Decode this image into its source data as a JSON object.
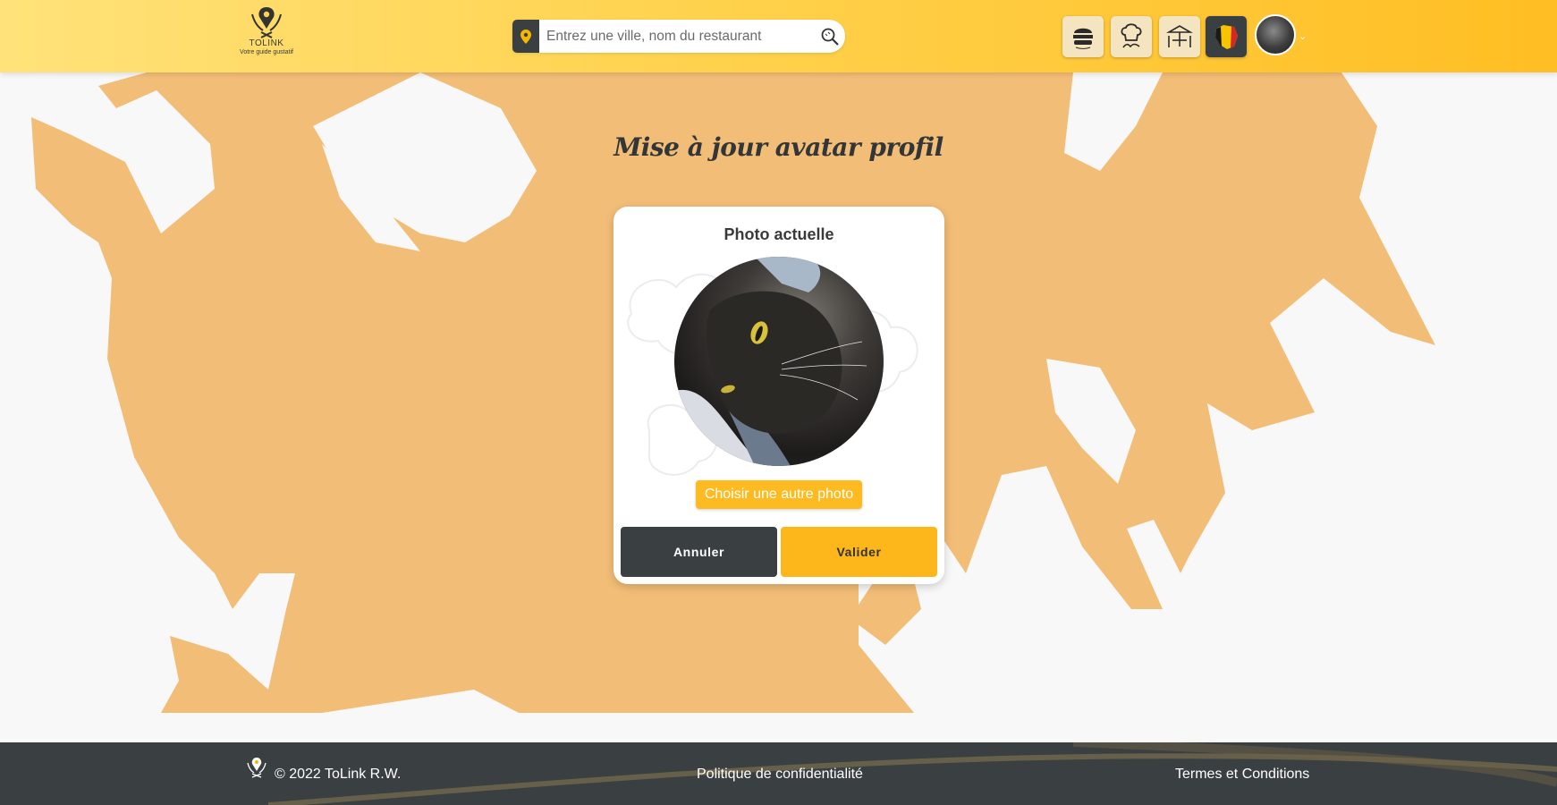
{
  "header": {
    "logo": {
      "name": "TOLINK",
      "tagline": "Votre guide gustatif"
    },
    "search": {
      "placeholder": "Entrez une ville, nom du restaurant",
      "value": ""
    },
    "category_tiles": [
      {
        "name": "burger-tile",
        "icon": "burger-icon"
      },
      {
        "name": "chef-tile",
        "icon": "chef-hat-icon"
      },
      {
        "name": "terrace-tile",
        "icon": "table-umbrella-icon"
      },
      {
        "name": "belgium-tile",
        "icon": "belgium-map-icon"
      }
    ]
  },
  "main": {
    "title": "Mise à jour avatar profil",
    "card": {
      "title": "Photo actuelle",
      "choose_label": "Choisir une autre photo",
      "cancel_label": "Annuler",
      "validate_label": "Valider"
    }
  },
  "footer": {
    "copyright": "© 2022 ToLink R.W.",
    "privacy": "Politique de confidentialité",
    "terms": "Termes et Conditions"
  },
  "colors": {
    "accent": "#fdbb21",
    "dark": "#3a3f42",
    "splash": "#f2bd77",
    "header_start": "#ffe27a",
    "header_end": "#ffbe23"
  }
}
